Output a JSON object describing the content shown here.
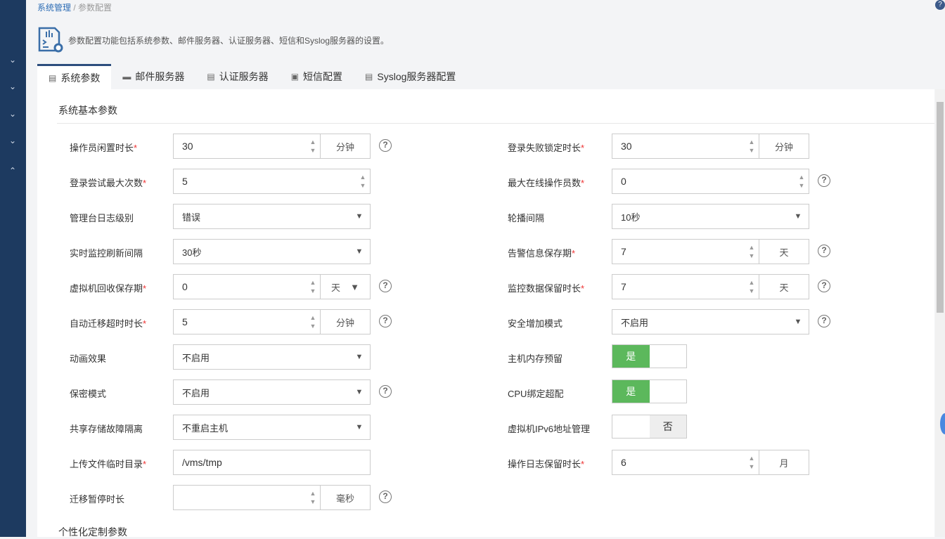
{
  "breadcrumb": {
    "parent": "系统管理",
    "separator": "/",
    "current": "参数配置"
  },
  "description": "参数配置功能包括系统参数、邮件服务器、认证服务器、短信和Syslog服务器的设置。",
  "tabs": [
    {
      "label": "系统参数",
      "icon": "settings-doc-icon"
    },
    {
      "label": "邮件服务器",
      "icon": "mail-server-icon"
    },
    {
      "label": "认证服务器",
      "icon": "auth-server-icon"
    },
    {
      "label": "短信配置",
      "icon": "sms-icon"
    },
    {
      "label": "Syslog服务器配置",
      "icon": "syslog-icon"
    }
  ],
  "section_basic": "系统基本参数",
  "section_custom": "个性化定制参数",
  "toggle_on": "是",
  "toggle_off": "否",
  "left_fields": [
    {
      "label": "操作员闲置时长",
      "required": true,
      "type": "number",
      "value": "30",
      "unit": "分钟",
      "help": true
    },
    {
      "label": "登录尝试最大次数",
      "required": true,
      "type": "number",
      "value": "5"
    },
    {
      "label": "管理台日志级别",
      "type": "select",
      "value": "错误"
    },
    {
      "label": "实时监控刷新间隔",
      "type": "select",
      "value": "30秒"
    },
    {
      "label": "虚拟机回收保存期",
      "required": true,
      "type": "number",
      "value": "0",
      "unit": "天",
      "unit_select": true,
      "help": true
    },
    {
      "label": "自动迁移超时时长",
      "required": true,
      "type": "number",
      "value": "5",
      "unit": "分钟",
      "help": true
    },
    {
      "label": "动画效果",
      "type": "select",
      "value": "不启用"
    },
    {
      "label": "保密模式",
      "type": "select",
      "value": "不启用",
      "help": true
    },
    {
      "label": "共享存储故障隔离",
      "type": "select",
      "value": "不重启主机"
    },
    {
      "label": "上传文件临时目录",
      "required": true,
      "type": "text",
      "value": "/vms/tmp"
    },
    {
      "label": "迁移暂停时长",
      "type": "number",
      "value": "",
      "unit": "毫秒",
      "help": true
    }
  ],
  "right_fields": [
    {
      "label": "登录失败锁定时长",
      "required": true,
      "type": "number",
      "value": "30",
      "unit": "分钟"
    },
    {
      "label": "最大在线操作员数",
      "required": true,
      "type": "number",
      "value": "0",
      "help": true
    },
    {
      "label": "轮播间隔",
      "type": "select",
      "value": "10秒"
    },
    {
      "label": "告警信息保存期",
      "required": true,
      "type": "number",
      "value": "7",
      "unit": "天",
      "help": true
    },
    {
      "label": "监控数据保留时长",
      "required": true,
      "type": "number",
      "value": "7",
      "unit": "天",
      "help": true
    },
    {
      "label": "安全增加模式",
      "type": "select",
      "value": "不启用",
      "help": true
    },
    {
      "label": "主机内存预留",
      "type": "toggle",
      "value": true
    },
    {
      "label": "CPU绑定超配",
      "type": "toggle",
      "value": true
    },
    {
      "label": "虚拟机IPv6地址管理",
      "type": "toggle",
      "value": false
    },
    {
      "label": "操作日志保留时长",
      "required": true,
      "type": "number",
      "value": "6",
      "unit": "月"
    }
  ]
}
